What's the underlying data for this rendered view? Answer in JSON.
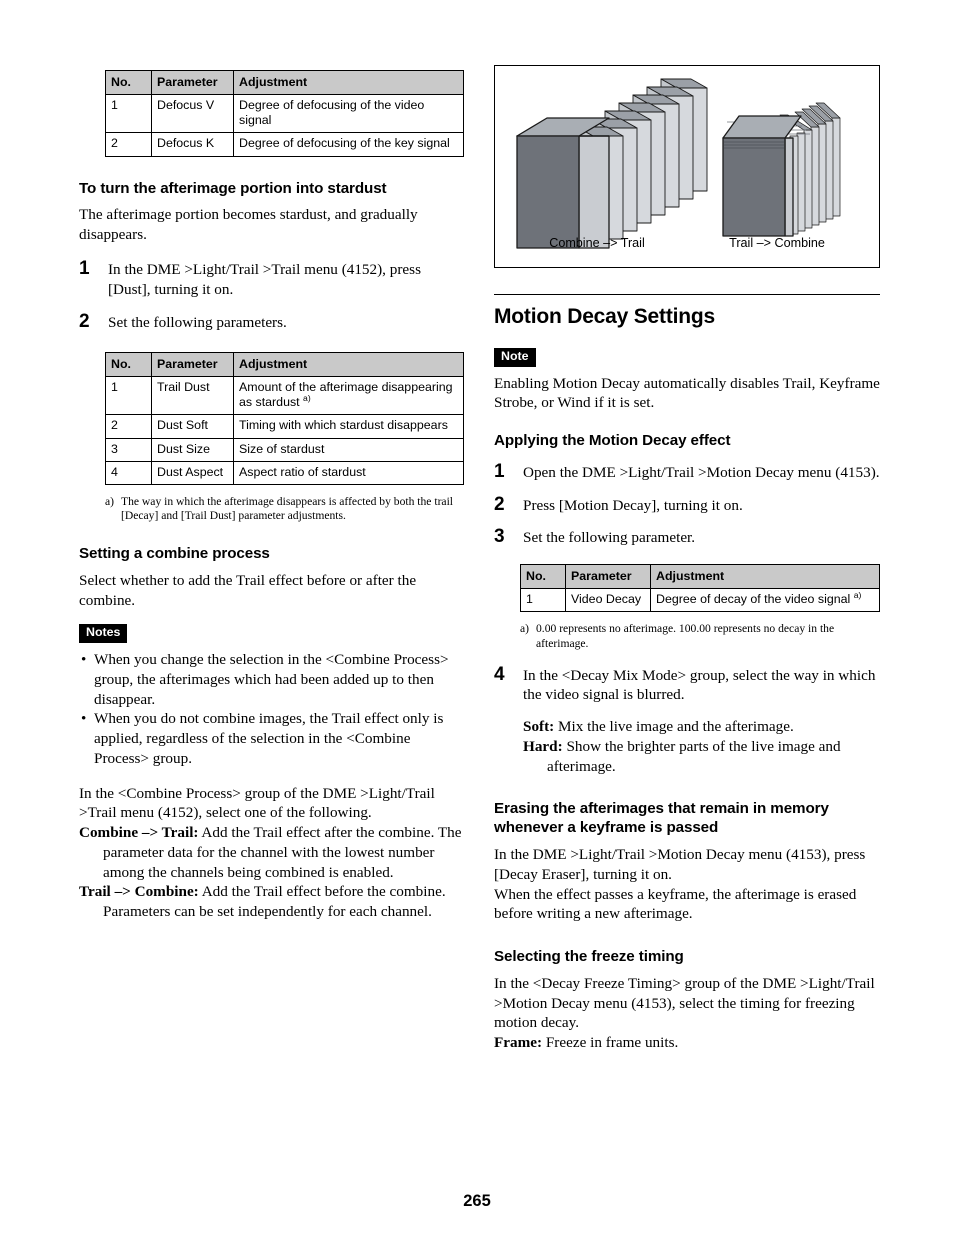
{
  "page": {
    "number": "265"
  },
  "left_column": {
    "table_defocus": {
      "headers": [
        "No.",
        "Parameter",
        "Adjustment"
      ],
      "rows": [
        {
          "no": "1",
          "parameter": "Defocus V",
          "adjustment": "Degree of defocusing of the video signal",
          "footnote": ""
        },
        {
          "no": "2",
          "parameter": "Defocus K",
          "adjustment": "Degree of defocusing of the key signal",
          "footnote": ""
        }
      ]
    },
    "stardust": {
      "heading": "To turn the afterimage portion into stardust",
      "intro": "The afterimage portion becomes stardust, and gradually disappears.",
      "steps": [
        {
          "num": "1",
          "text": "In the DME >Light/Trail >Trail menu (4152), press [Dust], turning it on."
        },
        {
          "num": "2",
          "text": "Set the following parameters."
        }
      ]
    },
    "table_dust": {
      "headers": [
        "No.",
        "Parameter",
        "Adjustment"
      ],
      "rows": [
        {
          "no": "1",
          "parameter": "Trail Dust",
          "adjustment": "Amount of the afterimage disappearing as stardust ",
          "footnote": "a)"
        },
        {
          "no": "2",
          "parameter": "Dust Soft",
          "adjustment": "Timing with which stardust disappears",
          "footnote": ""
        },
        {
          "no": "3",
          "parameter": "Dust Size",
          "adjustment": "Size of stardust",
          "footnote": ""
        },
        {
          "no": "4",
          "parameter": "Dust Aspect",
          "adjustment": "Aspect ratio of stardust",
          "footnote": ""
        }
      ],
      "footnote_mark": "a)",
      "footnote_text": "The way in which the afterimage disappears is affected by both the trail [Decay] and [Trail Dust] parameter adjustments."
    },
    "combine": {
      "heading": "Setting a combine process",
      "intro": "Select whether to add the Trail effect before or after the combine.",
      "notes_badge": "Notes",
      "notes": [
        "When you change the selection in the <Combine Process> group, the afterimages which had been added up to then disappear.",
        "When you do not combine images, the Trail effect only is applied, regardless of the selection in the <Combine Process> group."
      ],
      "lead": "In the <Combine Process> group of the DME >Light/Trail >Trail menu (4152), select one of the following.",
      "definitions": [
        {
          "term": "Combine –> Trail:",
          "text": " Add the Trail effect after the combine. The parameter data for the channel with the lowest number among the channels being combined is enabled."
        },
        {
          "term": "Trail –> Combine:",
          "text": " Add the Trail effect before the combine. Parameters can be set independently for each channel."
        }
      ]
    }
  },
  "right_column": {
    "figure": {
      "caption_left": "Combine –> Trail",
      "caption_right": "Trail –> Combine",
      "colors": {
        "front_face": "#6e7279",
        "top_face": "#a9aeb4",
        "side_face": "#c9ccd1",
        "plate_top": "#9ba0a7",
        "plate_face": "#d6d9dd",
        "outline": "#1a1a1a"
      }
    },
    "motion_decay": {
      "heading": "Motion Decay Settings",
      "note_badge": "Note",
      "note_text": "Enabling Motion Decay automatically disables Trail, Keyframe Strobe, or Wind if it is set."
    },
    "applying": {
      "heading": "Applying the Motion Decay effect",
      "steps": [
        {
          "num": "1",
          "text": "Open the DME >Light/Trail >Motion Decay menu (4153)."
        },
        {
          "num": "2",
          "text": "Press [Motion Decay], turning it on."
        },
        {
          "num": "3",
          "text": "Set the following parameter."
        }
      ],
      "table": {
        "headers": [
          "No.",
          "Parameter",
          "Adjustment"
        ],
        "rows": [
          {
            "no": "1",
            "parameter": "Video Decay",
            "adjustment": "Degree of decay of the video signal ",
            "footnote": "a)"
          }
        ],
        "footnote_mark": "a)",
        "footnote_text": "0.00 represents no afterimage. 100.00 represents no decay in the afterimage."
      },
      "step4": {
        "num": "4",
        "text": "In the <Decay Mix Mode> group, select the way in which the video signal is blurred."
      },
      "mix_modes": [
        {
          "term": "Soft:",
          "text": " Mix the live image and the afterimage."
        },
        {
          "term": "Hard:",
          "text": " Show the brighter parts of the live image and afterimage."
        }
      ]
    },
    "erasing": {
      "heading": "Erasing the afterimages that remain in memory whenever a keyframe is passed",
      "paragraph1": "In the DME >Light/Trail >Motion Decay menu (4153), press [Decay Eraser], turning it on.",
      "paragraph2": "When the effect passes a keyframe, the afterimage is erased before writing a new afterimage."
    },
    "freeze": {
      "heading": "Selecting the freeze timing",
      "paragraph": "In the <Decay Freeze Timing> group of the DME >Light/Trail >Motion Decay menu (4153), select the timing for freezing motion decay.",
      "frame_term": "Frame:",
      "frame_text": " Freeze in frame units."
    }
  }
}
